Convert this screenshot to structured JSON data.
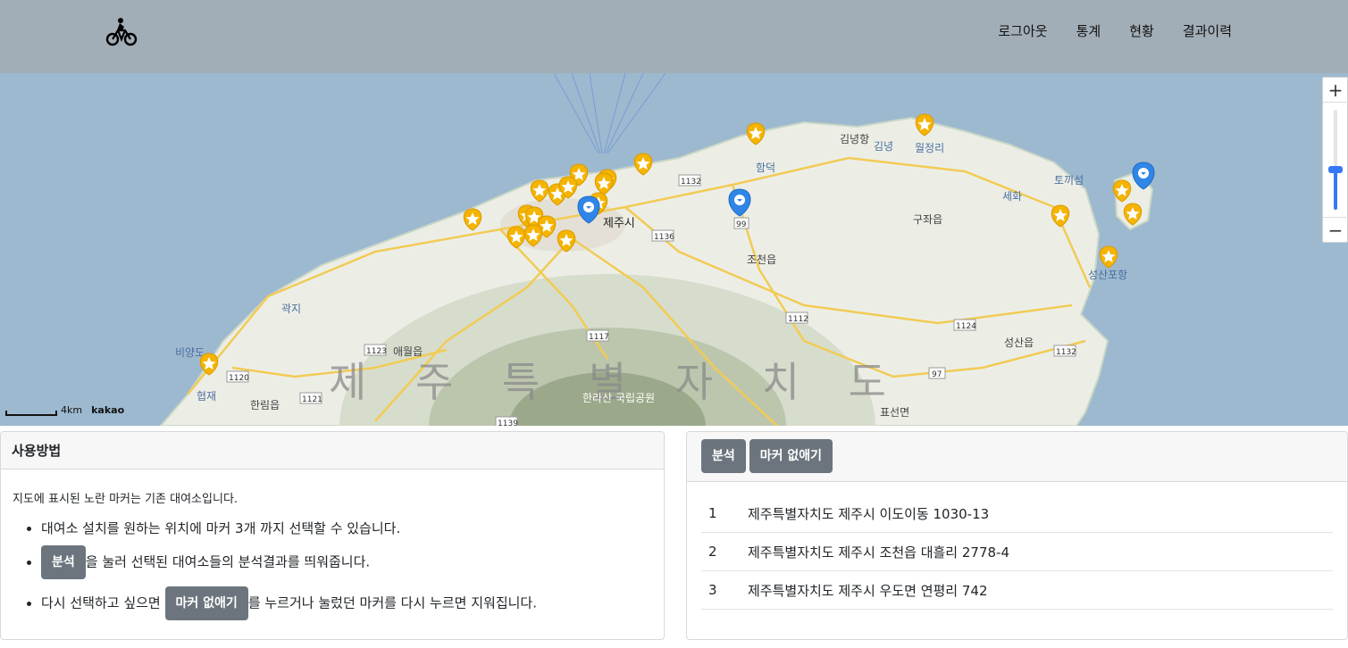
{
  "nav": {
    "brand_icon": "bicycle-icon",
    "links": [
      "로그아웃",
      "통계",
      "현황",
      "결과이력"
    ]
  },
  "map": {
    "region_label": "제 주 특 별 자 치 도",
    "place_labels": [
      "제주시",
      "조천읍",
      "구좌읍",
      "성산읍",
      "표선면",
      "애월읍",
      "한림읍",
      "한라산 국립공원",
      "곽지",
      "협재",
      "비양도",
      "함덕",
      "김녕",
      "월정리",
      "세화",
      "토끼섬",
      "성산포항",
      "김녕항"
    ],
    "road_labels": [
      "1132",
      "1136",
      "99",
      "1112",
      "1124",
      "1117",
      "1123",
      "1120",
      "1121",
      "1139",
      "97",
      "1132"
    ],
    "zoom_in": "+",
    "zoom_out": "−",
    "scale_label": "4km",
    "attribution": "kakao",
    "marker_legend": {
      "existing": "#f5b400",
      "selected": "#2f86e6"
    }
  },
  "usage": {
    "title": "사용방법",
    "intro": "지도에 표시된 노란 마커는 기존 대여소입니다.",
    "step1": "대여소 설치를 원하는 위치에 마커 3개 까지 선택할 수 있습니다.",
    "step2_btn": "분석",
    "step2_text": "을 눌러 선택된 대여소들의 분석결과를 띄워줍니다.",
    "step3_pre": "다시 선택하고 싶으면",
    "step3_btn": "마커 없애기",
    "step3_text": "를 누르거나 눌렀던 마커를 다시 누르면 지워집니다."
  },
  "results": {
    "analyze_btn": "분석",
    "clear_btn": "마커 없애기",
    "rows": [
      {
        "idx": "1",
        "address": "제주특별자치도 제주시 이도이동 1030-13"
      },
      {
        "idx": "2",
        "address": "제주특별자치도 제주시 조천읍 대흘리 2778-4"
      },
      {
        "idx": "3",
        "address": "제주특별자치도 제주시 우도면 연평리 742"
      }
    ]
  }
}
